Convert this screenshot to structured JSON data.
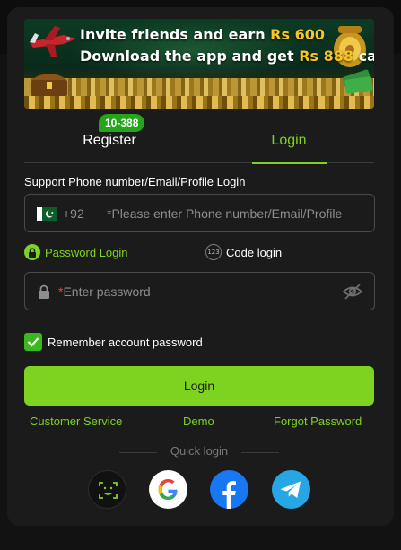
{
  "banner": {
    "line1_prefix": "Invite friends and earn ",
    "line1_amount": "Rs 600",
    "line2_prefix": "Download the app and get ",
    "line2_amount": "Rs 888",
    "line2_suffix": " cash"
  },
  "tabs": {
    "register": "Register",
    "login": "Login",
    "badge": "10-388",
    "active": "login"
  },
  "form": {
    "support_label": "Support Phone number/Email/Profile Login",
    "dial_code": "+92",
    "phone_required_mark": "*",
    "phone_placeholder": "Please enter Phone number/Email/Profile",
    "mode_password": "Password Login",
    "mode_code": "Code login",
    "mode_code_icon_text": "123",
    "password_required_mark": "*",
    "password_placeholder": "Enter password",
    "remember_label": "Remember account password",
    "remember_checked": true,
    "submit_label": "Login"
  },
  "links": {
    "customer_service": "Customer Service",
    "demo": "Demo",
    "forgot_password": "Forgot Password"
  },
  "quick_login": {
    "label": "Quick login",
    "providers": [
      "face-id-icon",
      "google-icon",
      "facebook-icon",
      "telegram-icon"
    ]
  },
  "colors": {
    "accent": "#7ed321",
    "background": "#1b1b1b",
    "badge": "#24a51b",
    "required": "#e64545"
  }
}
